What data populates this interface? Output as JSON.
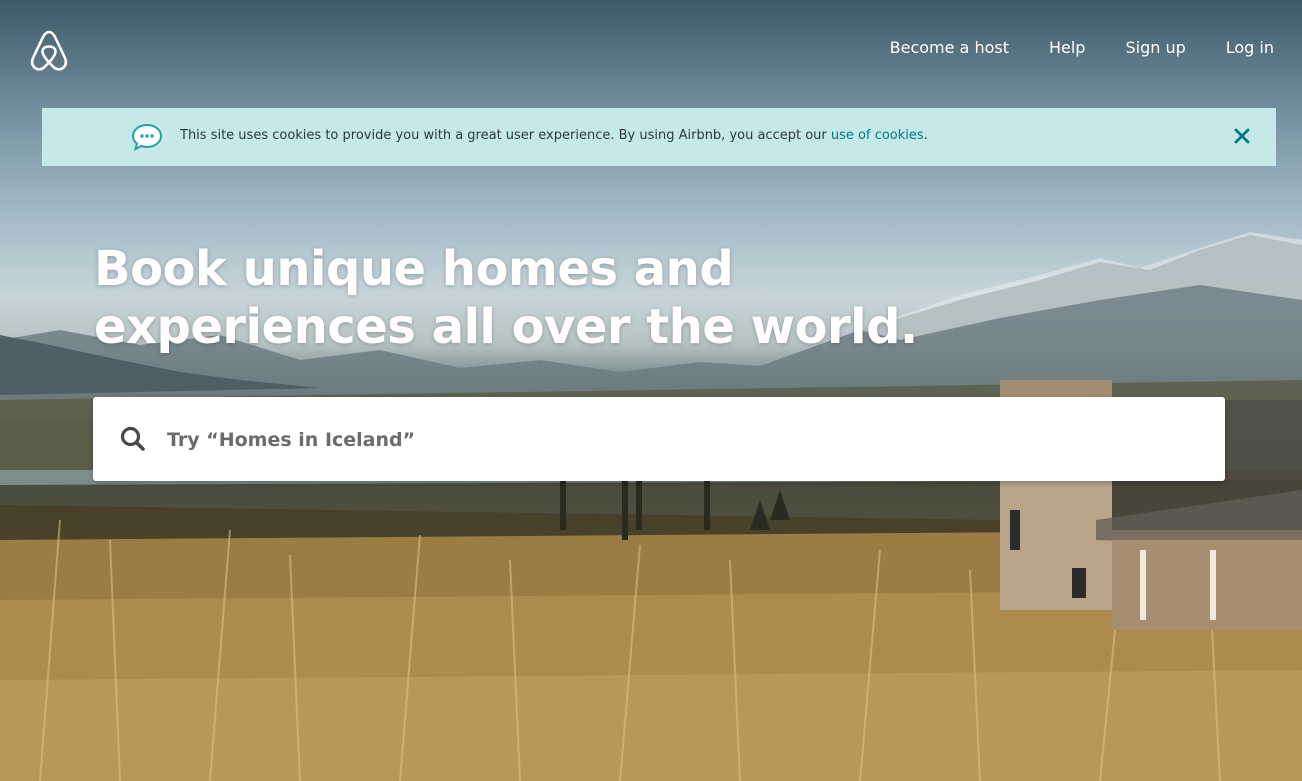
{
  "nav": {
    "logo": "airbnb-logo",
    "links": [
      "Become a host",
      "Help",
      "Sign up",
      "Log in"
    ]
  },
  "cookie_banner": {
    "text": "This site uses cookies to provide you with a great user experience. By using Airbnb, you accept our ",
    "link_text": "use of cookies",
    "suffix": ".",
    "icon": "chat-bubble-icon",
    "close_icon": "close-icon",
    "background": "#c5e8e9",
    "link_color": "#007a87"
  },
  "hero": {
    "headline_line1": "Book unique homes and",
    "headline_line2": "experiences all over the world."
  },
  "search": {
    "placeholder": "Try “Homes in Iceland”",
    "value": "",
    "icon": "search-icon"
  }
}
